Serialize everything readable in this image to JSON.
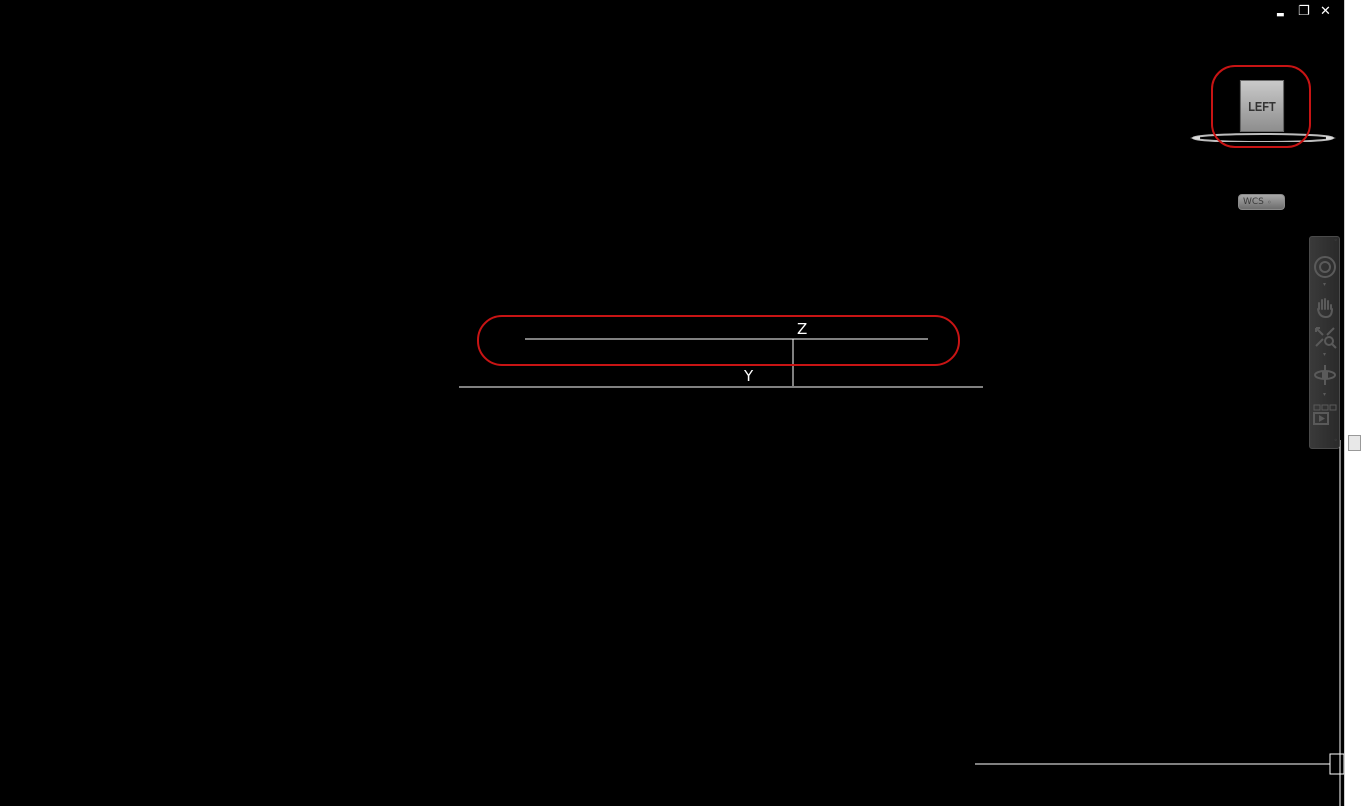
{
  "window": {
    "minimize_glyph": "▬",
    "restore_glyph": "❐",
    "close_glyph": "✕"
  },
  "viewcube": {
    "face_label": "LEFT",
    "icon": "viewcube-icon"
  },
  "ucs_menu": {
    "label": "WCS",
    "caret": "◦"
  },
  "navigation_bar": {
    "tools": [
      "steering-wheel-icon",
      "pan-icon",
      "zoom-extents-icon",
      "orbit-icon",
      "showmotion-icon"
    ]
  },
  "ucs_icon": {
    "z_label": "Z",
    "y_label": "Y"
  },
  "colors": {
    "background": "#000000",
    "highlight": "#c81414",
    "axis": "#ffffff"
  }
}
